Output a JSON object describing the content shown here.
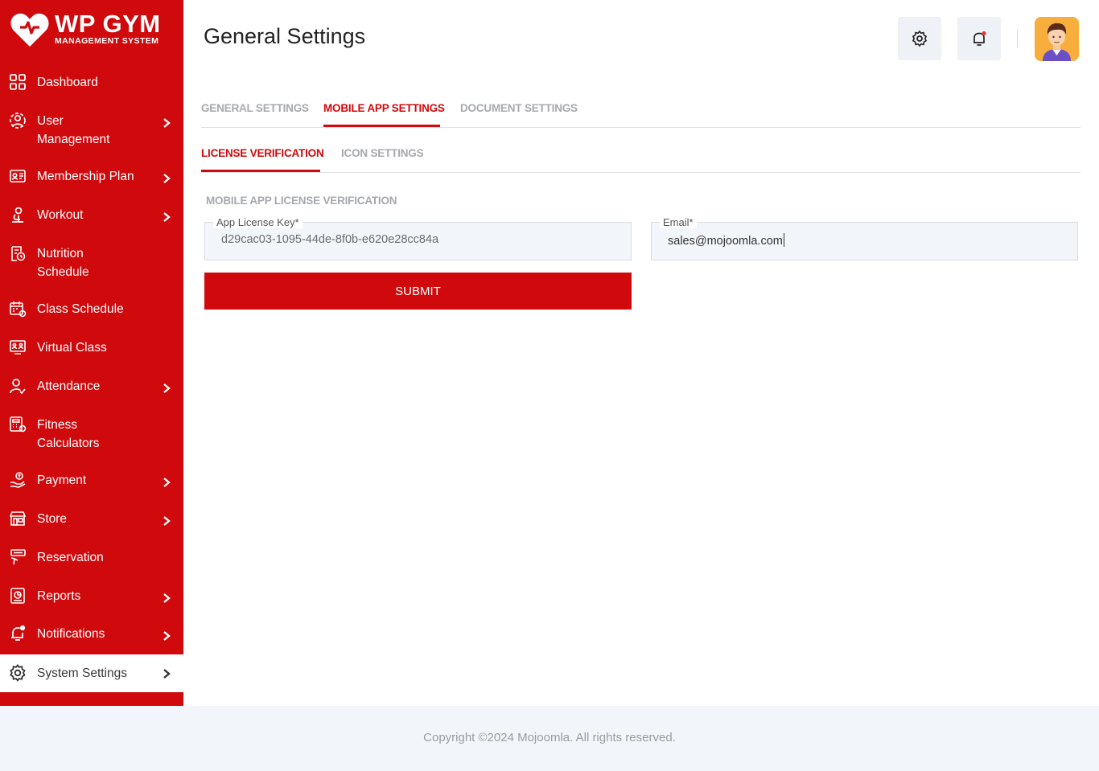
{
  "brand": {
    "name": "WP GYM",
    "tagline": "MANAGEMENT SYSTEM"
  },
  "sidebar": {
    "items": [
      {
        "label": "Dashboard",
        "icon": "dashboard-icon"
      },
      {
        "label": "User Management",
        "icon": "user-management-icon"
      },
      {
        "label": "Membership Plan",
        "icon": "membership-card-icon"
      },
      {
        "label": "Workout",
        "icon": "workout-icon"
      },
      {
        "label": "Nutrition Schedule",
        "icon": "nutrition-icon"
      },
      {
        "label": "Class Schedule",
        "icon": "calendar-icon"
      },
      {
        "label": "Virtual Class",
        "icon": "virtual-class-icon"
      },
      {
        "label": "Attendance",
        "icon": "attendance-icon"
      },
      {
        "label": "Fitness Calculators",
        "icon": "calculator-icon"
      },
      {
        "label": "Payment",
        "icon": "payment-icon"
      },
      {
        "label": "Store",
        "icon": "store-icon"
      },
      {
        "label": "Reservation",
        "icon": "reservation-icon"
      },
      {
        "label": "Reports",
        "icon": "reports-icon"
      },
      {
        "label": "Notifications",
        "icon": "notification-bell-icon"
      },
      {
        "label": "System Settings",
        "icon": "gear-icon"
      }
    ]
  },
  "header": {
    "title": "General Settings"
  },
  "tabs": {
    "main": [
      "GENERAL SETTINGS",
      "MOBILE APP SETTINGS",
      "DOCUMENT SETTINGS"
    ],
    "sub": [
      "LICENSE VERIFICATION",
      "ICON SETTINGS"
    ]
  },
  "form": {
    "section_title": "MOBILE APP LICENSE VERIFICATION",
    "license_label": "App License Key*",
    "license_value": "d29cac03-1095-44de-8f0b-e620e28cc84a",
    "email_label": "Email*",
    "email_value": "sales@mojoomla.com",
    "submit_label": "SUBMIT"
  },
  "footer": {
    "copyright": "Copyright ©2024 Mojoomla. All rights reserved."
  },
  "colors": {
    "accent": "#d0090d",
    "panel": "#f2f5fa"
  }
}
